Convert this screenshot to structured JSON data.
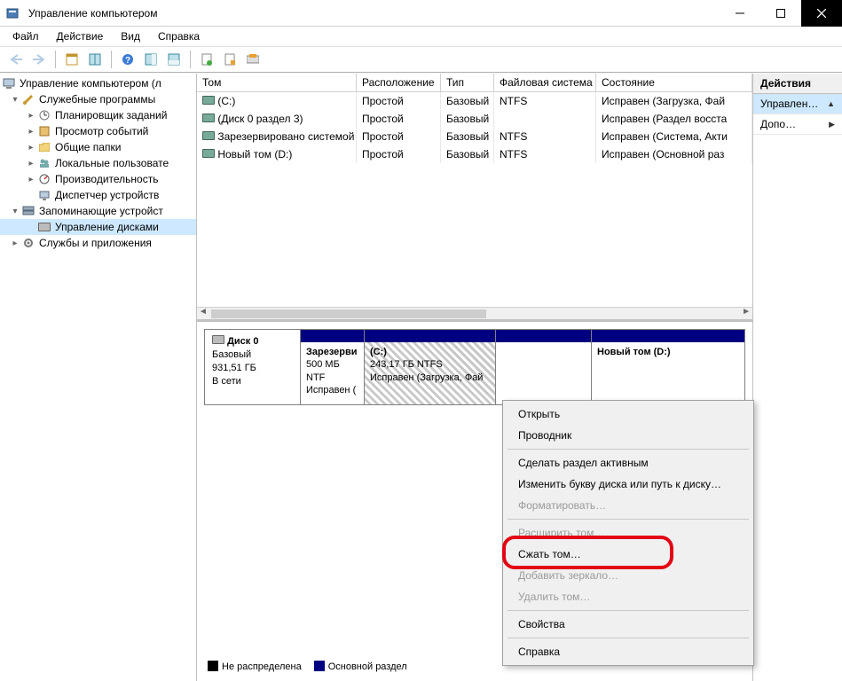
{
  "titlebar": {
    "title": "Управление компьютером"
  },
  "menu": {
    "file": "Файл",
    "action": "Действие",
    "view": "Вид",
    "help": "Справка"
  },
  "tree": {
    "root": "Управление компьютером (л",
    "svc": "Служебные программы",
    "sched": "Планировщик заданий",
    "evt": "Просмотр событий",
    "shared": "Общие папки",
    "users": "Локальные пользовате",
    "perf": "Производительность",
    "devmgr": "Диспетчер устройств",
    "storage": "Запоминающие устройст",
    "diskmgmt": "Управление дисками",
    "apps": "Службы и приложения"
  },
  "vol_headers": {
    "tom": "Том",
    "ras": "Расположение",
    "tip": "Тип",
    "fs": "Файловая система",
    "st": "Состояние"
  },
  "vols": [
    {
      "tom": "(C:)",
      "ras": "Простой",
      "tip": "Базовый",
      "fs": "NTFS",
      "st": "Исправен (Загрузка, Фай"
    },
    {
      "tom": "(Диск 0 раздел 3)",
      "ras": "Простой",
      "tip": "Базовый",
      "fs": "",
      "st": "Исправен (Раздел восста"
    },
    {
      "tom": "Зарезервировано системой",
      "ras": "Простой",
      "tip": "Базовый",
      "fs": "NTFS",
      "st": "Исправен (Система, Акти"
    },
    {
      "tom": "Новый том (D:)",
      "ras": "Простой",
      "tip": "Базовый",
      "fs": "NTFS",
      "st": "Исправен (Основной раз"
    }
  ],
  "disk": {
    "name": "Диск 0",
    "type": "Базовый",
    "size": "931,51 ГБ",
    "status": "В сети",
    "parts": {
      "reserved": {
        "title": "Зарезерви",
        "line2": "500 МБ NTF",
        "line3": "Исправен ("
      },
      "c": {
        "title": "(C:)",
        "line2": "243,17 ГБ NTFS",
        "line3": "Исправен (Загрузка, Фай"
      },
      "unalloc": {
        "title": "",
        "line2": "",
        "line3": ""
      },
      "d": {
        "title": "Новый том  (D:)",
        "line2": "",
        "line3": ""
      }
    }
  },
  "legend": {
    "unalloc": "Не распределена",
    "primary": "Основной раздел"
  },
  "actions": {
    "header": "Действия",
    "main": "Управлен…",
    "more": "Допо…"
  },
  "ctx": {
    "open": "Открыть",
    "explorer": "Проводник",
    "active": "Сделать раздел активным",
    "letter": "Изменить букву диска или путь к диску…",
    "format": "Форматировать…",
    "extend": "Расширить том…",
    "shrink": "Сжать том…",
    "mirror": "Добавить зеркало…",
    "delete": "Удалить том…",
    "props": "Свойства",
    "help": "Справка"
  }
}
